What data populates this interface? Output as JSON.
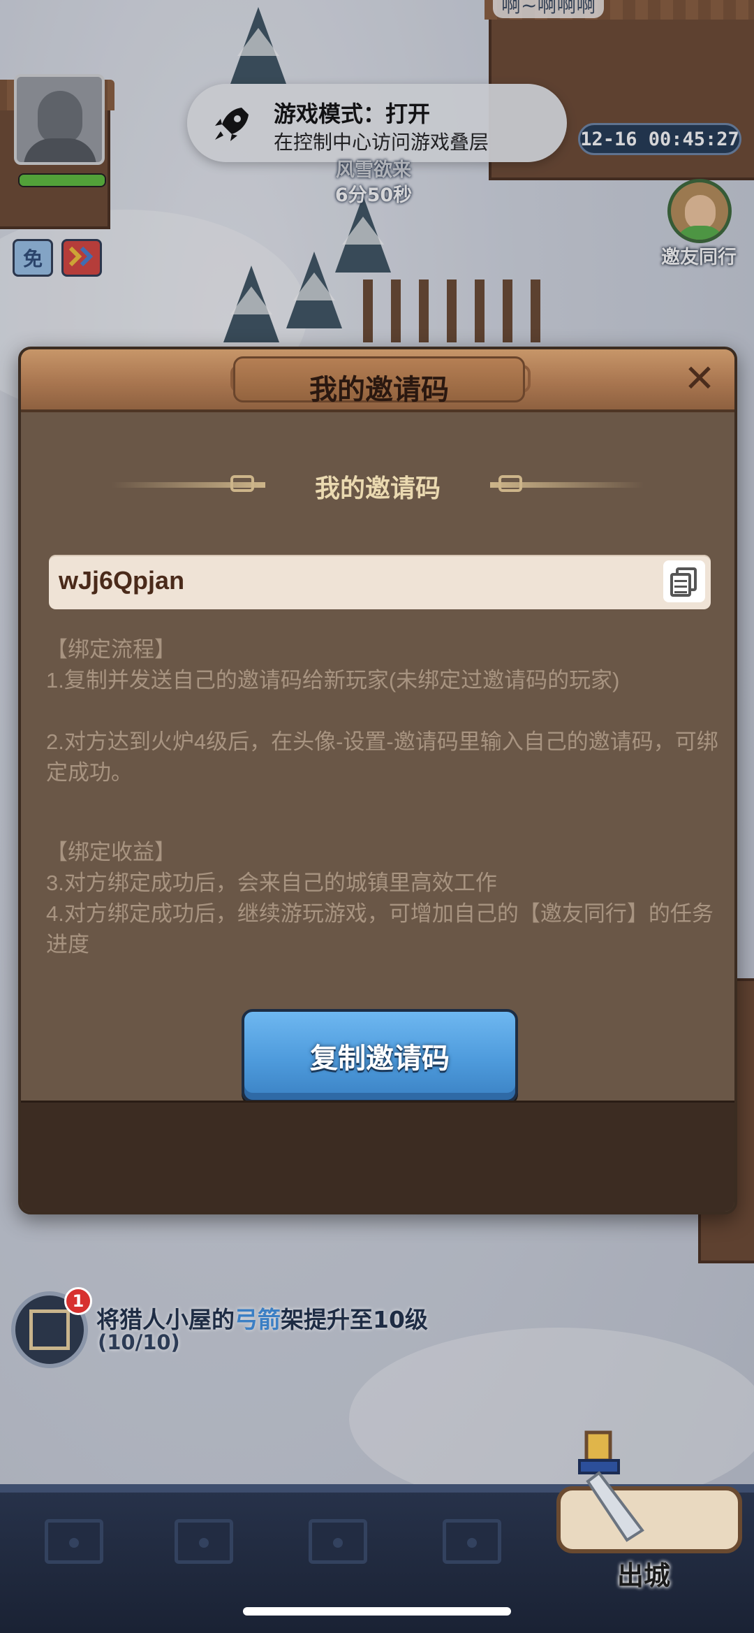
{
  "hud": {
    "top_cut_text": "啊~啊啊啊",
    "timer": "12-16 00:45:27",
    "storm_title": "风雪欲来",
    "storm_countdown": "6分50秒",
    "badge_free": "免",
    "friend_label": "邀友同行"
  },
  "notification": {
    "title": "游戏模式：打开",
    "subtitle": "在控制中心访问游戏叠层",
    "icon": "rocket-icon"
  },
  "modal": {
    "title": "我的邀请码",
    "section_title": "我的邀请码",
    "invite_code": "wJj6Qpjan",
    "bind_flow_header": "【绑定流程】",
    "bind_flow_1": "1.复制并发送自己的邀请码给新玩家(未绑定过邀请码的玩家)",
    "bind_flow_2": "2.对方达到火炉4级后，在头像-设置-邀请码里输入自己的邀请码，可绑定成功。",
    "bind_reward_header": "【绑定收益】",
    "bind_reward_3": "3.对方绑定成功后，会来自己的城镇里高效工作",
    "bind_reward_4": "4.对方绑定成功后，继续游玩游戏，可增加自己的【邀友同行】的任务进度",
    "copy_button": "复制邀请码"
  },
  "quest": {
    "badge_count": "1",
    "text_before": "将猎人小屋的",
    "text_highlight": "弓箭",
    "text_after": "架提升至10级",
    "progress": "(10/10)"
  },
  "bottom": {
    "exit_label": "出城"
  },
  "colors": {
    "modal_bg": "#6a5747",
    "header_wood": "#a97650",
    "button_blue": "#4e9bdc",
    "text_muted": "#a89481",
    "section_gold": "#ead9b0"
  }
}
